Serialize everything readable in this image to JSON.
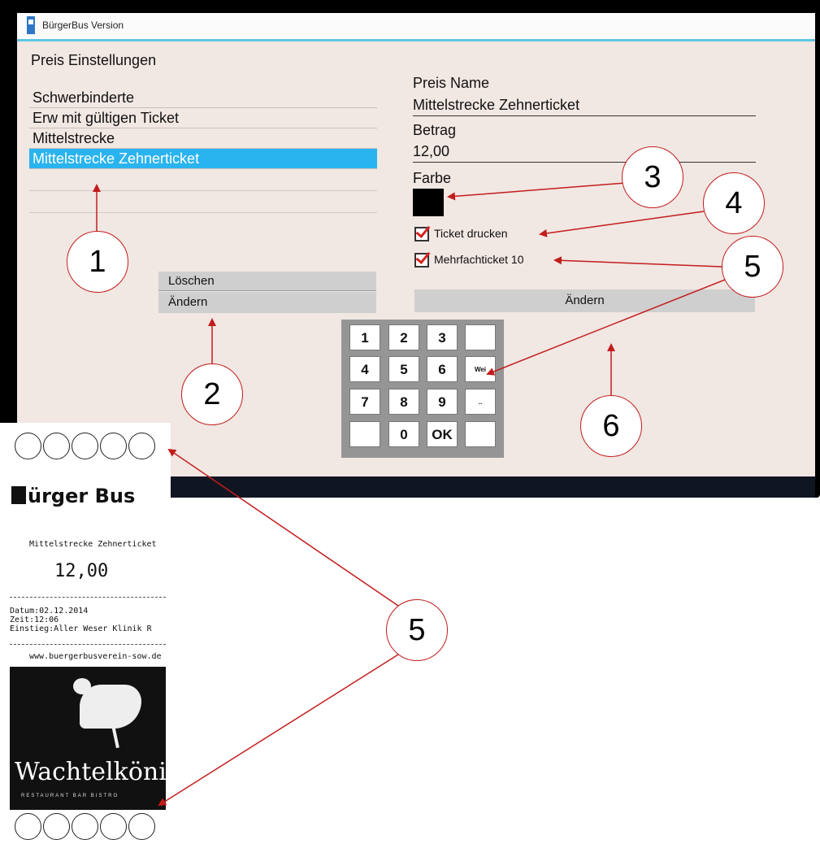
{
  "window": {
    "title": "BürgerBus Version"
  },
  "section_title": "Preis Einstellungen",
  "price_list": {
    "items": [
      {
        "label": "Schwerbinderte",
        "selected": false
      },
      {
        "label": "Erw mit gültigen Ticket",
        "selected": false
      },
      {
        "label": "Mittelstrecke",
        "selected": false
      },
      {
        "label": "Mittelstrecke Zehnerticket",
        "selected": true
      }
    ]
  },
  "left_buttons": {
    "delete_label": "Löschen",
    "change_label": "Ändern"
  },
  "form": {
    "name_label": "Preis Name",
    "name_value": "Mittelstrecke Zehnerticket",
    "amount_label": "Betrag",
    "amount_value": "12,00",
    "color_label": "Farbe",
    "color_value": "#000000",
    "print_ticket_label": "Ticket drucken",
    "print_ticket_checked": true,
    "multi_ticket_label": "Mehrfachticket 10",
    "multi_ticket_checked": true,
    "change_label": "Ändern"
  },
  "keypad": {
    "keys": [
      "1",
      "2",
      "3",
      "",
      "4",
      "5",
      "6",
      "Wei",
      "7",
      "8",
      "9",
      "..",
      "",
      "0",
      "OK",
      ""
    ]
  },
  "callouts": [
    "1",
    "2",
    "3",
    "4",
    "5",
    "6",
    "5"
  ],
  "receipt": {
    "brand": "ürger Bus",
    "ticket_name": "Mittelstrecke Zehnerticket",
    "price": "12,00",
    "date_line": "Datum:02.12.2014",
    "time_line": "Zeit:12:06",
    "stop_line": "Einstieg:Aller Weser Klinik R",
    "url": "www.buergerbusverein-sow.de",
    "art_title": "Wachtelkönig",
    "art_subtitle": "RESTAURANT BAR BISTRO",
    "punch_count": 5
  },
  "colors": {
    "accent": "#2ab4ef",
    "annotation": "#c21d1d",
    "background": "#f1e7e3"
  }
}
